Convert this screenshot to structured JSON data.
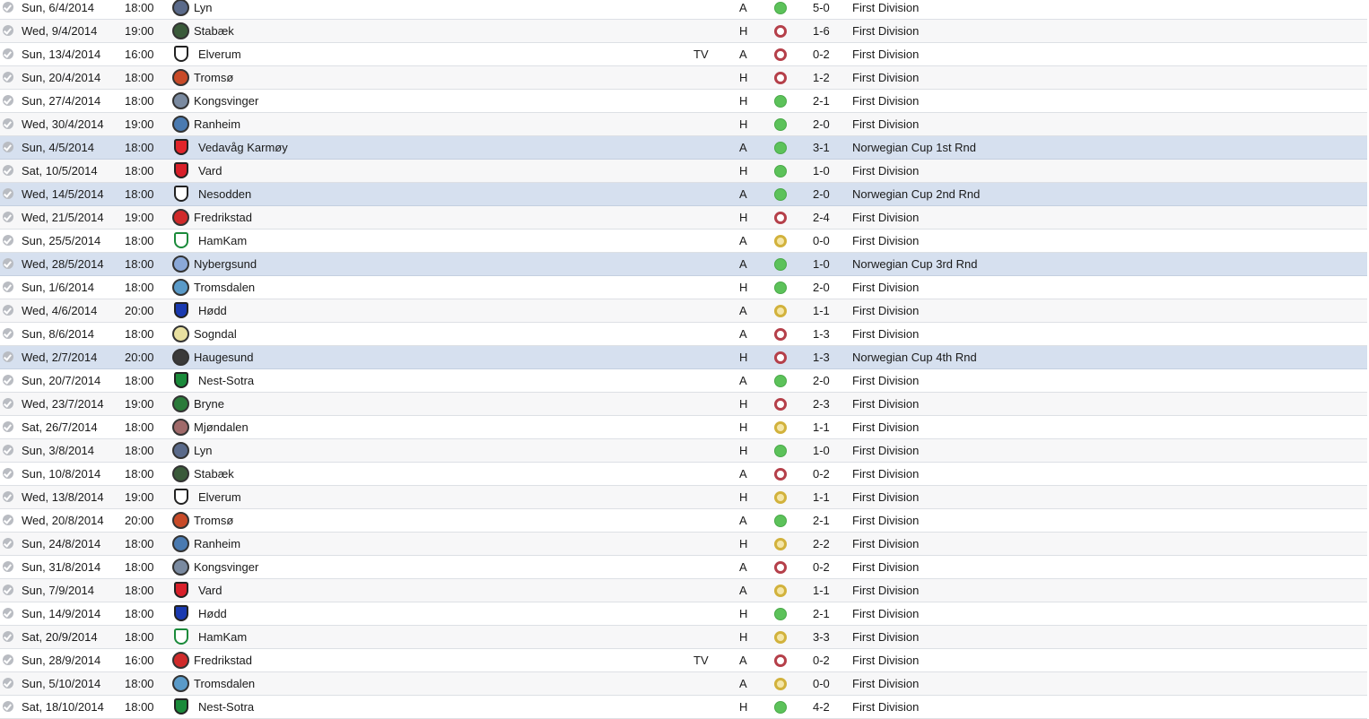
{
  "fixtures": [
    {
      "date": "Sun, 6/4/2014",
      "time": "18:00",
      "team": "Lyn",
      "tv": "",
      "venue": "A",
      "result": "W",
      "score": "5-0",
      "competition": "First Division",
      "crest": "circle",
      "color": "#5a6a8a"
    },
    {
      "date": "Wed, 9/4/2014",
      "time": "19:00",
      "team": "Stabæk",
      "tv": "",
      "venue": "H",
      "result": "L",
      "score": "1-6",
      "competition": "First Division",
      "crest": "circle",
      "color": "#3a5a3a"
    },
    {
      "date": "Sun, 13/4/2014",
      "time": "16:00",
      "team": "Elverum",
      "tv": "TV",
      "venue": "A",
      "result": "L",
      "score": "0-2",
      "competition": "First Division",
      "crest": "shield",
      "color": "#ffffff"
    },
    {
      "date": "Sun, 20/4/2014",
      "time": "18:00",
      "team": "Tromsø",
      "tv": "",
      "venue": "H",
      "result": "L",
      "score": "1-2",
      "competition": "First Division",
      "crest": "circle",
      "color": "#c84a28"
    },
    {
      "date": "Sun, 27/4/2014",
      "time": "18:00",
      "team": "Kongsvinger",
      "tv": "",
      "venue": "H",
      "result": "W",
      "score": "2-1",
      "competition": "First Division",
      "crest": "circle",
      "color": "#7a8aa0"
    },
    {
      "date": "Wed, 30/4/2014",
      "time": "19:00",
      "team": "Ranheim",
      "tv": "",
      "venue": "H",
      "result": "W",
      "score": "2-0",
      "competition": "First Division",
      "crest": "circle",
      "color": "#4a7ab0"
    },
    {
      "date": "Sun, 4/5/2014",
      "time": "18:00",
      "team": "Vedavåg Karmøy",
      "tv": "",
      "venue": "A",
      "result": "W",
      "score": "3-1",
      "competition": "Norwegian Cup 1st Rnd",
      "crest": "shield",
      "color": "#e0242a"
    },
    {
      "date": "Sat, 10/5/2014",
      "time": "18:00",
      "team": "Vard",
      "tv": "",
      "venue": "H",
      "result": "W",
      "score": "1-0",
      "competition": "First Division",
      "crest": "shield",
      "color": "#d8202a"
    },
    {
      "date": "Wed, 14/5/2014",
      "time": "18:00",
      "team": "Nesodden",
      "tv": "",
      "venue": "A",
      "result": "W",
      "score": "2-0",
      "competition": "Norwegian Cup 2nd Rnd",
      "crest": "shield",
      "color": "#ffffff"
    },
    {
      "date": "Wed, 21/5/2014",
      "time": "19:00",
      "team": "Fredrikstad",
      "tv": "",
      "venue": "H",
      "result": "L",
      "score": "2-4",
      "competition": "First Division",
      "crest": "circle",
      "color": "#d02a2a"
    },
    {
      "date": "Sun, 25/5/2014",
      "time": "18:00",
      "team": "HamKam",
      "tv": "",
      "venue": "A",
      "result": "D",
      "score": "0-0",
      "competition": "First Division",
      "crest": "shield",
      "color": "#ffffff",
      "stroke": "#1a8a3a"
    },
    {
      "date": "Wed, 28/5/2014",
      "time": "18:00",
      "team": "Nybergsund",
      "tv": "",
      "venue": "A",
      "result": "W",
      "score": "1-0",
      "competition": "Norwegian Cup 3rd Rnd",
      "crest": "circle",
      "color": "#8aa8d8"
    },
    {
      "date": "Sun, 1/6/2014",
      "time": "18:00",
      "team": "Tromsdalen",
      "tv": "",
      "venue": "H",
      "result": "W",
      "score": "2-0",
      "competition": "First Division",
      "crest": "circle",
      "color": "#5a9ac8"
    },
    {
      "date": "Wed, 4/6/2014",
      "time": "20:00",
      "team": "Hødd",
      "tv": "",
      "venue": "A",
      "result": "D",
      "score": "1-1",
      "competition": "First Division",
      "crest": "shield",
      "color": "#1a3ab0"
    },
    {
      "date": "Sun, 8/6/2014",
      "time": "18:00",
      "team": "Sogndal",
      "tv": "",
      "venue": "A",
      "result": "L",
      "score": "1-3",
      "competition": "First Division",
      "crest": "circle",
      "color": "#e8e0a0"
    },
    {
      "date": "Wed, 2/7/2014",
      "time": "20:00",
      "team": "Haugesund",
      "tv": "",
      "venue": "H",
      "result": "L",
      "score": "1-3",
      "competition": "Norwegian Cup 4th Rnd",
      "crest": "circle",
      "color": "#3a3a3a"
    },
    {
      "date": "Sun, 20/7/2014",
      "time": "18:00",
      "team": "Nest-Sotra",
      "tv": "",
      "venue": "A",
      "result": "W",
      "score": "2-0",
      "competition": "First Division",
      "crest": "shield",
      "color": "#1a8a3a"
    },
    {
      "date": "Wed, 23/7/2014",
      "time": "19:00",
      "team": "Bryne",
      "tv": "",
      "venue": "H",
      "result": "L",
      "score": "2-3",
      "competition": "First Division",
      "crest": "circle",
      "color": "#2a7a3a"
    },
    {
      "date": "Sat, 26/7/2014",
      "time": "18:00",
      "team": "Mjøndalen",
      "tv": "",
      "venue": "H",
      "result": "D",
      "score": "1-1",
      "competition": "First Division",
      "crest": "circle",
      "color": "#a06a6a"
    },
    {
      "date": "Sun, 3/8/2014",
      "time": "18:00",
      "team": "Lyn",
      "tv": "",
      "venue": "H",
      "result": "W",
      "score": "1-0",
      "competition": "First Division",
      "crest": "circle",
      "color": "#5a6a8a"
    },
    {
      "date": "Sun, 10/8/2014",
      "time": "18:00",
      "team": "Stabæk",
      "tv": "",
      "venue": "A",
      "result": "L",
      "score": "0-2",
      "competition": "First Division",
      "crest": "circle",
      "color": "#3a5a3a"
    },
    {
      "date": "Wed, 13/8/2014",
      "time": "19:00",
      "team": "Elverum",
      "tv": "",
      "venue": "H",
      "result": "D",
      "score": "1-1",
      "competition": "First Division",
      "crest": "shield",
      "color": "#ffffff"
    },
    {
      "date": "Wed, 20/8/2014",
      "time": "20:00",
      "team": "Tromsø",
      "tv": "",
      "venue": "A",
      "result": "W",
      "score": "2-1",
      "competition": "First Division",
      "crest": "circle",
      "color": "#c84a28"
    },
    {
      "date": "Sun, 24/8/2014",
      "time": "18:00",
      "team": "Ranheim",
      "tv": "",
      "venue": "H",
      "result": "D",
      "score": "2-2",
      "competition": "First Division",
      "crest": "circle",
      "color": "#4a7ab0"
    },
    {
      "date": "Sun, 31/8/2014",
      "time": "18:00",
      "team": "Kongsvinger",
      "tv": "",
      "venue": "A",
      "result": "L",
      "score": "0-2",
      "competition": "First Division",
      "crest": "circle",
      "color": "#7a8aa0"
    },
    {
      "date": "Sun, 7/9/2014",
      "time": "18:00",
      "team": "Vard",
      "tv": "",
      "venue": "A",
      "result": "D",
      "score": "1-1",
      "competition": "First Division",
      "crest": "shield",
      "color": "#d8202a"
    },
    {
      "date": "Sun, 14/9/2014",
      "time": "18:00",
      "team": "Hødd",
      "tv": "",
      "venue": "H",
      "result": "W",
      "score": "2-1",
      "competition": "First Division",
      "crest": "shield",
      "color": "#1a3ab0"
    },
    {
      "date": "Sat, 20/9/2014",
      "time": "18:00",
      "team": "HamKam",
      "tv": "",
      "venue": "H",
      "result": "D",
      "score": "3-3",
      "competition": "First Division",
      "crest": "shield",
      "color": "#ffffff",
      "stroke": "#1a8a3a"
    },
    {
      "date": "Sun, 28/9/2014",
      "time": "16:00",
      "team": "Fredrikstad",
      "tv": "TV",
      "venue": "A",
      "result": "L",
      "score": "0-2",
      "competition": "First Division",
      "crest": "circle",
      "color": "#d02a2a"
    },
    {
      "date": "Sun, 5/10/2014",
      "time": "18:00",
      "team": "Tromsdalen",
      "tv": "",
      "venue": "A",
      "result": "D",
      "score": "0-0",
      "competition": "First Division",
      "crest": "circle",
      "color": "#5a9ac8"
    },
    {
      "date": "Sat, 18/10/2014",
      "time": "18:00",
      "team": "Nest-Sotra",
      "tv": "",
      "venue": "H",
      "result": "W",
      "score": "4-2",
      "competition": "First Division",
      "crest": "shield",
      "color": "#1a8a3a"
    }
  ]
}
